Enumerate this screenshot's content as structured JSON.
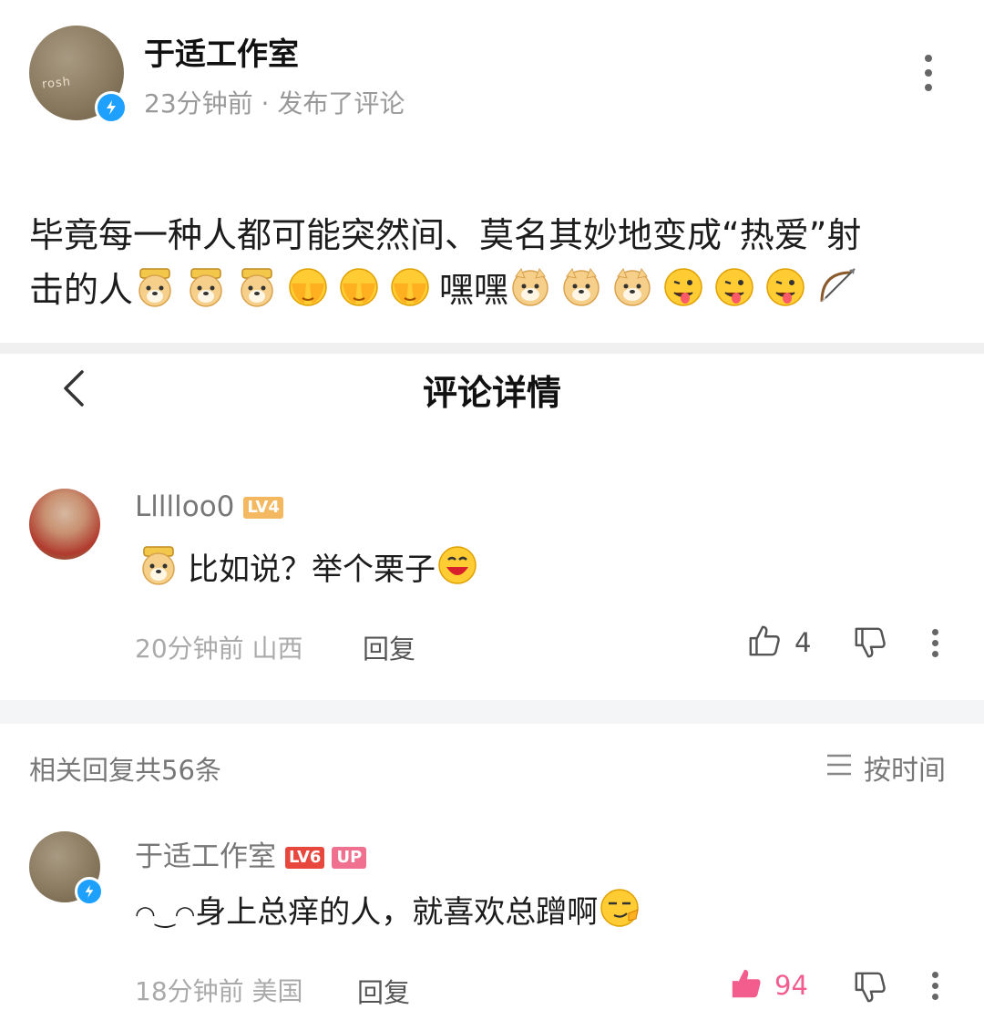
{
  "post": {
    "author": "于适工作室",
    "meta": "23分钟前 · 发布了评论",
    "avatar_text": "rosh",
    "text_line1": "毕竟每一种人都可能突然间、莫名其妙地变成“热爱”射",
    "text_line2_prefix": "击的人",
    "text_line2_middle": "嘿嘿"
  },
  "detail": {
    "title": "评论详情"
  },
  "comment1": {
    "username": "Llllloo0",
    "level": "LV4",
    "text": "比如说？举个栗子",
    "time": "20分钟前 山西",
    "reply": "回复",
    "likes": "4"
  },
  "related": {
    "count_label": "相关回复共56条",
    "sort_label": "按时间"
  },
  "comment2": {
    "username": "于适工作室",
    "level": "LV6",
    "up_badge": "UP",
    "text_prefix": "◠‿◠",
    "text": "身上总痒的人，就喜欢总蹭啊",
    "time": "18分钟前 美国",
    "reply": "回复",
    "likes": "94"
  },
  "colors": {
    "lv4": "#f4b860",
    "lv6": "#e8473e",
    "verified": "#1ea0ff",
    "like_active": "#f25d8e"
  },
  "icons": [
    "back-icon",
    "more-icon",
    "thumbs-up-icon",
    "thumbs-down-icon",
    "sort-icon",
    "verified-icon"
  ]
}
